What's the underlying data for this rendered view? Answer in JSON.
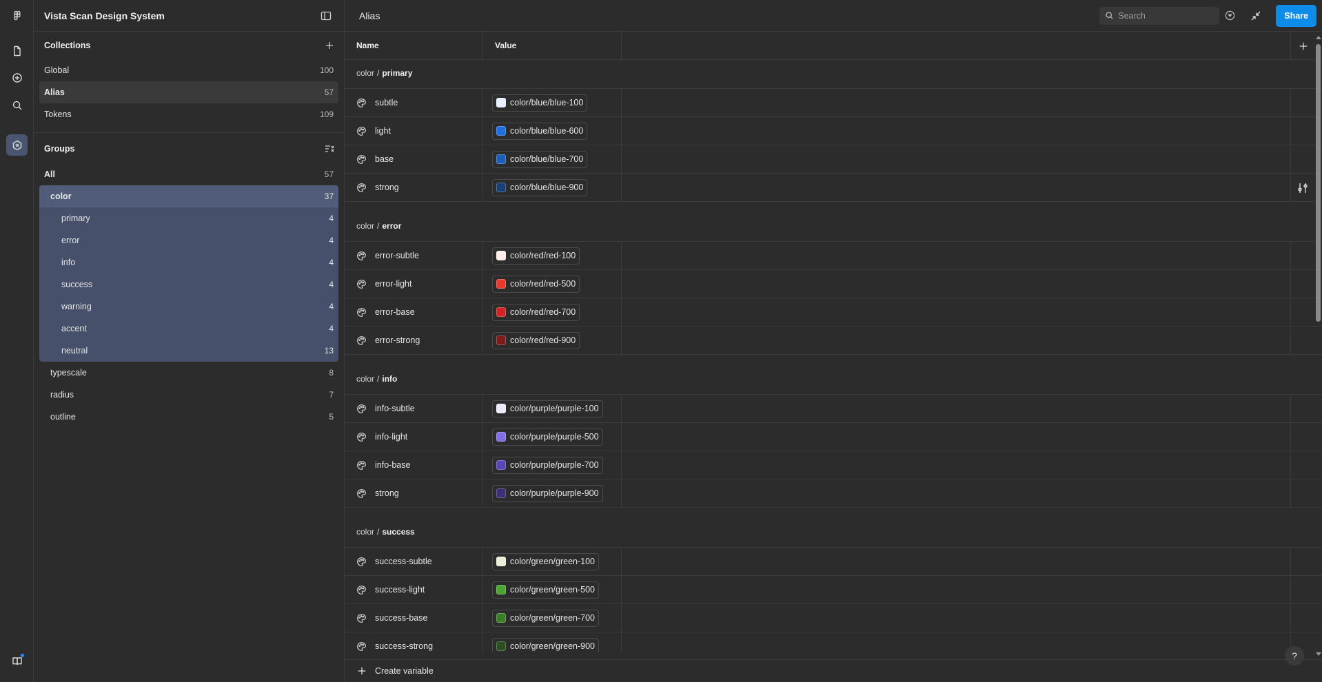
{
  "rail": {
    "items": [
      {
        "icon": "figma-logo-icon"
      },
      {
        "icon": "file-icon"
      },
      {
        "icon": "plus-circle-icon"
      },
      {
        "icon": "search-icon"
      },
      {
        "icon": "variables-icon",
        "active": true
      },
      {
        "icon": "book-icon"
      }
    ]
  },
  "sidebar": {
    "title": "Vista Scan Design System",
    "collections_label": "Collections",
    "collections": [
      {
        "name": "Global",
        "count": "100"
      },
      {
        "name": "Alias",
        "count": "57",
        "active": true
      },
      {
        "name": "Tokens",
        "count": "109"
      }
    ],
    "groups_label": "Groups",
    "groups": {
      "all": {
        "name": "All",
        "count": "57"
      },
      "color": {
        "name": "color",
        "count": "37"
      },
      "color_children": [
        {
          "name": "primary",
          "count": "4"
        },
        {
          "name": "error",
          "count": "4"
        },
        {
          "name": "info",
          "count": "4"
        },
        {
          "name": "success",
          "count": "4"
        },
        {
          "name": "warning",
          "count": "4"
        },
        {
          "name": "accent",
          "count": "4"
        },
        {
          "name": "neutral",
          "count": "13"
        }
      ],
      "others": [
        {
          "name": "typescale",
          "count": "8"
        },
        {
          "name": "radius",
          "count": "7"
        },
        {
          "name": "outline",
          "count": "5"
        }
      ]
    }
  },
  "header": {
    "title": "Alias",
    "search_placeholder": "Search",
    "share_label": "Share"
  },
  "table": {
    "col_name": "Name",
    "col_value": "Value",
    "groups": [
      {
        "prefix": "color",
        "sep": "/",
        "name": "primary",
        "rows": [
          {
            "name": "subtle",
            "value": "color/blue/blue-100",
            "color": "#e6f0ff"
          },
          {
            "name": "light",
            "value": "color/blue/blue-600",
            "color": "#1f6fe0"
          },
          {
            "name": "base",
            "value": "color/blue/blue-700",
            "color": "#1d5fb8"
          },
          {
            "name": "strong",
            "value": "color/blue/blue-900",
            "color": "#1a3f75"
          }
        ]
      },
      {
        "prefix": "color",
        "sep": "/",
        "name": "error",
        "rows": [
          {
            "name": "error-subtle",
            "value": "color/red/red-100",
            "color": "#fdeeea"
          },
          {
            "name": "error-light",
            "value": "color/red/red-500",
            "color": "#e83a2f"
          },
          {
            "name": "error-base",
            "value": "color/red/red-700",
            "color": "#cf2424"
          },
          {
            "name": "error-strong",
            "value": "color/red/red-900",
            "color": "#7d1c1c"
          }
        ]
      },
      {
        "prefix": "color",
        "sep": "/",
        "name": "info",
        "rows": [
          {
            "name": "info-subtle",
            "value": "color/purple/purple-100",
            "color": "#ecebfb"
          },
          {
            "name": "info-light",
            "value": "color/purple/purple-500",
            "color": "#7f6fe3"
          },
          {
            "name": "info-base",
            "value": "color/purple/purple-700",
            "color": "#5b46b8"
          },
          {
            "name": "strong",
            "value": "color/purple/purple-900",
            "color": "#3f2f78"
          }
        ]
      },
      {
        "prefix": "color",
        "sep": "/",
        "name": "success",
        "rows": [
          {
            "name": "success-subtle",
            "value": "color/green/green-100",
            "color": "#eaeed9"
          },
          {
            "name": "success-light",
            "value": "color/green/green-500",
            "color": "#4aa631"
          },
          {
            "name": "success-base",
            "value": "color/green/green-700",
            "color": "#3a7f25"
          },
          {
            "name": "success-strong",
            "value": "color/green/green-900",
            "color": "#2b4f1d"
          }
        ]
      }
    ],
    "create_label": "Create variable"
  },
  "help_label": "?"
}
